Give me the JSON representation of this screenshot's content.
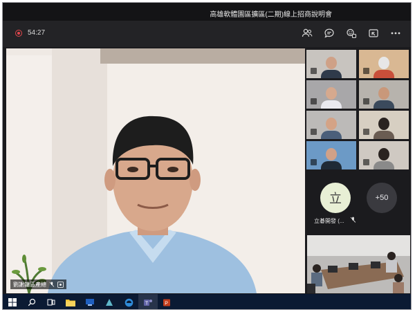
{
  "window": {
    "title": "高雄軟體園區擴區(二期)線上招商說明會"
  },
  "call": {
    "timer": "54:27",
    "icons": [
      "participants-icon",
      "chat-icon",
      "reactions-icon",
      "share-tray-icon",
      "more-options-icon"
    ]
  },
  "speaker": {
    "name": "劉謝鏞區產總"
  },
  "avatars": {
    "tile_initial": "立",
    "tile_name": "立碁開發 (...",
    "overflow_count": "+50"
  },
  "taskbar": {
    "apps": [
      "windows-start-icon",
      "search-icon",
      "task-view-icon",
      "file-explorer-icon",
      "app-icon",
      "app-icon",
      "edge-icon",
      "teams-icon",
      "powerpoint-icon"
    ]
  },
  "colors": {
    "record_red": "#e5484d",
    "taskbar_bg": "#0b1a33",
    "app_bg": "#1b1b1e"
  }
}
